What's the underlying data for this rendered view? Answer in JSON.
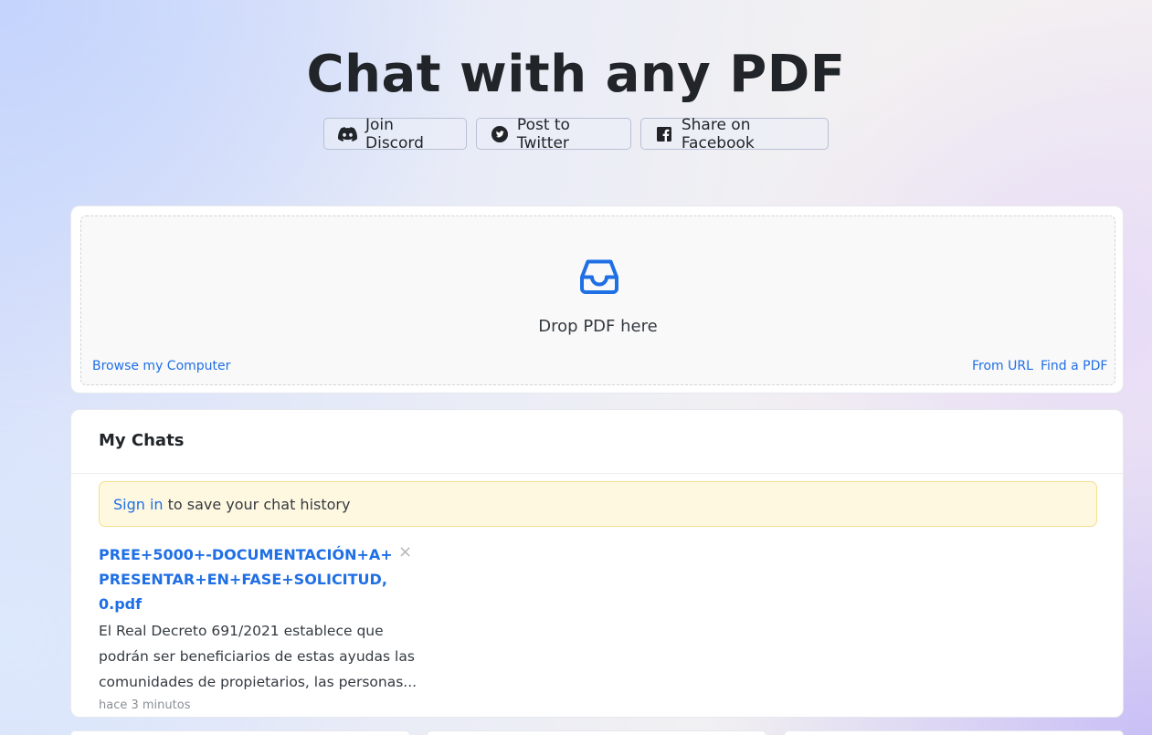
{
  "header": {
    "title": "Chat with any PDF"
  },
  "share": {
    "discord_label": "Join Discord",
    "twitter_label": "Post to Twitter",
    "facebook_label": "Share on Facebook"
  },
  "upload": {
    "drop_label": "Drop PDF here",
    "browse_label": "Browse my Computer",
    "url_label": "From URL",
    "find_label": "Find a PDF",
    "accent_color": "#1f6fe5"
  },
  "chats": {
    "title": "My Chats",
    "notice": {
      "signin_label": "Sign in",
      "text": "to save your chat history"
    },
    "items": [
      {
        "name": "PREE+5000+-DOCUMENTACIÓN+A+PRESENTAR+EN+FASE+SOLICITUD,0.pdf",
        "description": "El Real Decreto 691/2021 establece que podrán ser beneficiarios de estas ayudas las comunidades de propietarios, las personas...",
        "time": "hace 3 minutos",
        "close_label": "×"
      }
    ]
  }
}
